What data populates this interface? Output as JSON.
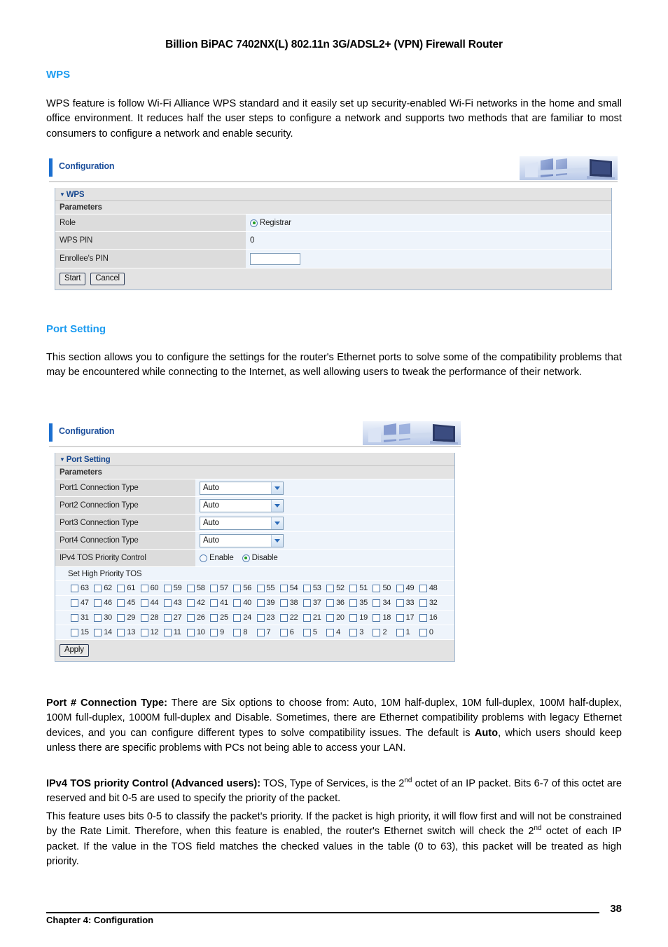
{
  "document": {
    "running_head": "Billion BiPAC 7402NX(L) 802.11n 3G/ADSL2+ (VPN) Firewall Router",
    "footer_chapter": "Chapter 4: Configuration",
    "page_number": "38",
    "heading_color": "#1b9bf0"
  },
  "wps_section": {
    "heading": "WPS",
    "paragraph": "WPS feature is follow Wi-Fi Alliance WPS standard and it easily set up security-enabled Wi-Fi networks in the home and small office environment. It reduces half the user steps to configure a network and supports two methods that are familiar to most consumers to configure a network and enable security."
  },
  "wps_panel": {
    "topbar_label": "Configuration",
    "block_title": "WPS",
    "sub_header": "Parameters",
    "rows": [
      {
        "label": "Role",
        "value": "Registrar",
        "type": "radio",
        "checked": true
      },
      {
        "label": "WPS PIN",
        "value": "0",
        "type": "text"
      },
      {
        "label": "Enrollee's PIN",
        "value": "",
        "type": "input",
        "placeholder": ""
      }
    ],
    "buttons": [
      {
        "label": "Start"
      },
      {
        "label": "Cancel"
      }
    ]
  },
  "port_section": {
    "heading": "Port Setting",
    "paragraph": "This section allows you to configure the settings for the router's Ethernet ports to solve some of the compatibility problems that may be encountered while connecting to the Internet, as well allowing users to tweak the performance of their network."
  },
  "port_panel": {
    "topbar_label": "Configuration",
    "block_title": "Port Setting",
    "sub_header": "Parameters",
    "port_rows": [
      {
        "label": "Port1 Connection Type",
        "value": "Auto"
      },
      {
        "label": "Port2 Connection Type",
        "value": "Auto"
      },
      {
        "label": "Port3 Connection Type",
        "value": "Auto"
      },
      {
        "label": "Port4 Connection Type",
        "value": "Auto"
      }
    ],
    "select_options": [
      "Auto",
      "10M half-duplex",
      "10M full-duplex",
      "100M half-duplex",
      "100M full-duplex",
      "1000M full-duplex",
      "Disable"
    ],
    "tos_control": {
      "label": "IPv4 TOS Priority Control",
      "options": [
        {
          "label": "Enable",
          "checked": false
        },
        {
          "label": "Disable",
          "checked": true
        }
      ]
    },
    "tos_grid_label": "Set High Priority TOS",
    "tos_rows": [
      [
        "63",
        "62",
        "61",
        "60",
        "59",
        "58",
        "57",
        "56",
        "55",
        "54",
        "53",
        "52",
        "51",
        "50",
        "49",
        "48"
      ],
      [
        "47",
        "46",
        "45",
        "44",
        "43",
        "42",
        "41",
        "40",
        "39",
        "38",
        "37",
        "36",
        "35",
        "34",
        "33",
        "32"
      ],
      [
        "31",
        "30",
        "29",
        "28",
        "27",
        "26",
        "25",
        "24",
        "23",
        "22",
        "21",
        "20",
        "19",
        "18",
        "17",
        "16"
      ],
      [
        "15",
        "14",
        "13",
        "12",
        "11",
        "10",
        "9",
        "8",
        "7",
        "6",
        "5",
        "4",
        "3",
        "2",
        "1",
        "0"
      ]
    ],
    "apply_button": "Apply"
  },
  "explanations": {
    "port_type_title": "Port # Connection Type:",
    "port_type_body": " There are Six options to choose from: Auto, 10M half-duplex, 10M full-duplex, 100M half-duplex, 100M full-duplex, 1000M full-duplex and Disable. Sometimes, there are Ethernet compatibility problems with legacy Ethernet devices, and you can configure different types to solve compatibility issues. The default is ",
    "port_type_default": "Auto",
    "port_type_tail": ", which users should keep unless there are specific problems with PCs not being able to access your LAN.",
    "tos_title": "IPv4 TOS priority Control (Advanced users):",
    "tos_body_a": " TOS, Type of Services, is the 2",
    "tos_sup_a": "nd",
    "tos_body_b": " octet of an IP packet. Bits 6-7 of this octet are reserved and bit 0-5 are used to specify the priority of the packet.",
    "tos_para2_a": "This feature uses bits 0-5 to classify the packet's priority. If the packet is high priority, it will flow first and will not be constrained by the Rate Limit.   Therefore, when this feature is enabled, the router's Ethernet switch will check the 2",
    "tos_para2_sup": "nd",
    "tos_para2_b": " octet of each IP packet. If the value in the TOS field matches the checked values in the table (0 to 63), this packet will be treated as high priority."
  }
}
